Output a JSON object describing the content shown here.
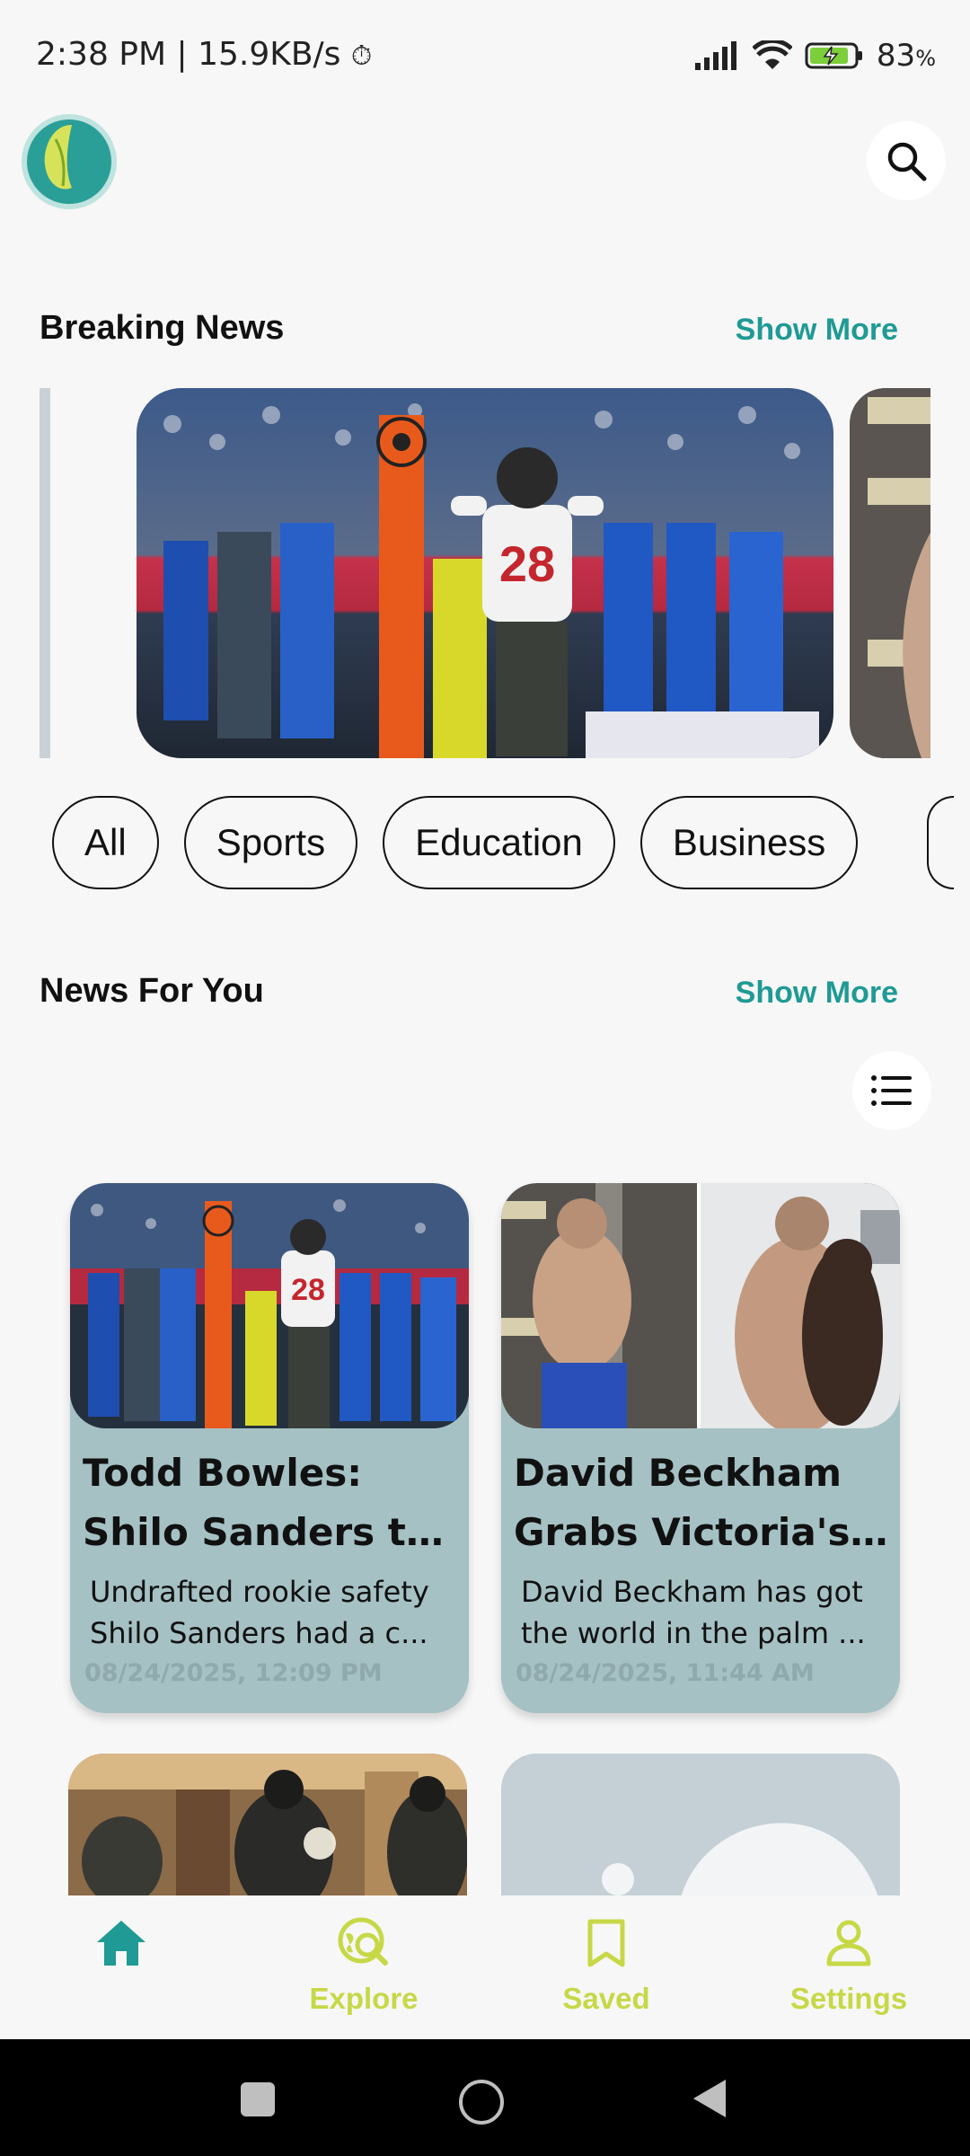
{
  "status_bar": {
    "time_speed": "2:38 PM | 15.9KB/s",
    "battery": "83",
    "battery_unit": "%"
  },
  "header": {
    "logo_icon": "leaf-logo-icon",
    "search_icon": "search-icon"
  },
  "breaking": {
    "title": "Breaking News",
    "show_more": "Show More"
  },
  "categories": [
    "All",
    "Sports",
    "Education",
    "Business"
  ],
  "for_you": {
    "title": "News For You",
    "show_more": "Show More",
    "layout_toggle_icon": "list-icon"
  },
  "news_cards": [
    {
      "title_line1": "Todd Bowles:",
      "title_line2": "Shilo Sanders th...",
      "summary_line1": "Undrafted rookie safety",
      "summary_line2": "Shilo Sanders had a c...",
      "date": "08/24/2025, 12:09 PM"
    },
    {
      "title_line1": "David Beckham",
      "title_line2": "Grabs Victoria's...",
      "summary_line1": "David Beckham has got",
      "summary_line2": "the world in the palm ...",
      "date": "08/24/2025, 11:44 AM"
    }
  ],
  "bottom_nav": [
    {
      "label": "",
      "icon": "home-icon",
      "active": true
    },
    {
      "label": "Explore",
      "icon": "explore-icon"
    },
    {
      "label": "Saved",
      "icon": "bookmark-icon"
    },
    {
      "label": "Settings",
      "icon": "person-icon"
    }
  ],
  "colors": {
    "accent": "#1f9a94",
    "nav_inactive": "#c7d847",
    "card_bg": "#a5c1c4"
  }
}
